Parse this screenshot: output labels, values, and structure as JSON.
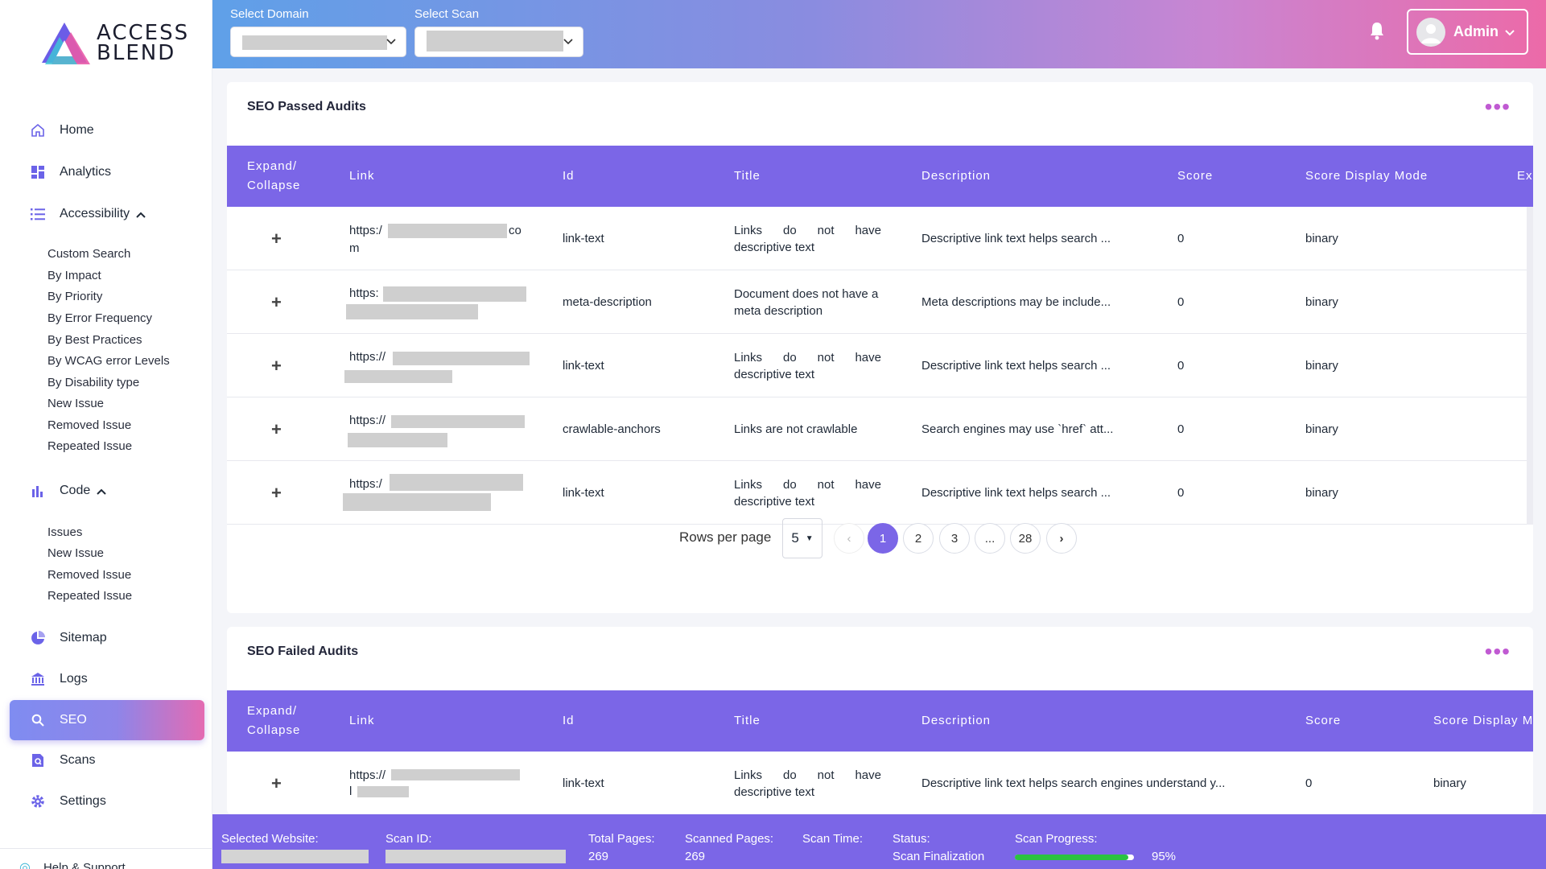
{
  "brand": {
    "line1": "ACCESS",
    "line2": "BLEND"
  },
  "colors": {
    "accent": "#7b66e7",
    "progress": "#2bc241"
  },
  "nav": {
    "home": "Home",
    "analytics": "Analytics",
    "accessibility": "Accessibility",
    "accessibility_sub": [
      "Custom Search",
      "By Impact",
      "By Priority",
      "By Error Frequency",
      "By Best Practices",
      "By WCAG error Levels",
      "By Disability type",
      "New Issue",
      "Removed Issue",
      "Repeated Issue"
    ],
    "code": "Code",
    "code_sub": [
      "Issues",
      "New Issue",
      "Removed Issue",
      "Repeated Issue"
    ],
    "sitemap": "Sitemap",
    "logs": "Logs",
    "seo": "SEO",
    "scans": "Scans",
    "settings": "Settings",
    "help": "Help & Support"
  },
  "topbar": {
    "domain_label": "Select Domain",
    "scan_label": "Select Scan",
    "admin": "Admin"
  },
  "passed": {
    "title": "SEO Passed Audits",
    "columns": [
      "Expand/ Collapse",
      "Link",
      "Id",
      "Title",
      "Description",
      "Score",
      "Score Display Mode",
      "Ex"
    ],
    "rows": [
      {
        "link_a": "https:/",
        "link_b": "co",
        "link_c": "m",
        "id": "link-text",
        "title": "Links do not have descriptive text",
        "desc": "Descriptive link text helps search ...",
        "score": "0",
        "mode": "binary"
      },
      {
        "link_a": "https:",
        "link_b": "",
        "link_c": "",
        "id": "meta-description",
        "title": "Document does not have a meta description",
        "desc": "Meta descriptions may be include...",
        "score": "0",
        "mode": "binary"
      },
      {
        "link_a": "https://",
        "link_b": "",
        "link_c": "",
        "id": "link-text",
        "title": "Links do not have descriptive text",
        "desc": "Descriptive link text helps search ...",
        "score": "0",
        "mode": "binary"
      },
      {
        "link_a": "https://",
        "link_b": "",
        "link_c": "",
        "id": "crawlable-anchors",
        "title": "Links are not crawlable",
        "desc": "Search engines may use `href` att...",
        "score": "0",
        "mode": "binary"
      },
      {
        "link_a": "https:/",
        "link_b": "",
        "link_c": "",
        "id": "link-text",
        "title": "Links do not have descriptive text",
        "desc": "Descriptive link text helps search ...",
        "score": "0",
        "mode": "binary"
      }
    ],
    "rows_per_page_label": "Rows per page",
    "rows_per_page": "5",
    "pages": [
      "1",
      "2",
      "3",
      "...",
      "28"
    ]
  },
  "failed": {
    "title": "SEO Failed Audits",
    "columns": [
      "Expand/ Collapse",
      "Link",
      "Id",
      "Title",
      "Description",
      "Score",
      "Score Display M"
    ],
    "rows": [
      {
        "link_a": "https://",
        "link_c": "l",
        "id": "link-text",
        "title": "Links do not have descriptive text",
        "desc": "Descriptive link text helps search engines understand y...",
        "score": "0",
        "mode": "binary"
      }
    ]
  },
  "footer": {
    "website_label": "Selected Website:",
    "scan_id_label": "Scan ID:",
    "total_label": "Total Pages:",
    "total": "269",
    "scanned_label": "Scanned Pages:",
    "scanned": "269",
    "time_label": "Scan Time:",
    "status_label": "Status:",
    "status": "Scan Finalization",
    "progress_label": "Scan Progress:",
    "progress": "95%",
    "progress_value": 0.95
  }
}
